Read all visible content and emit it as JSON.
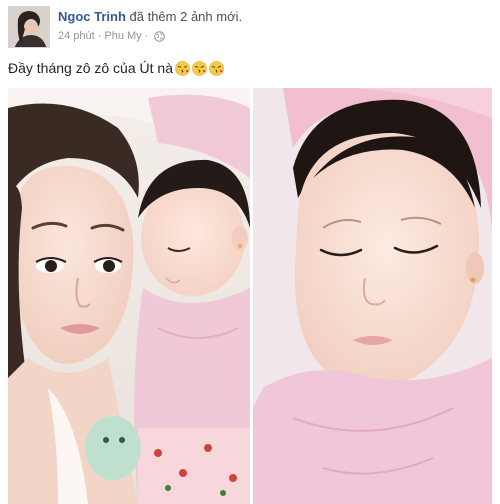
{
  "post": {
    "author_name": "Ngoc Trinh",
    "action": "đã thêm 2 ảnh mới.",
    "time": "24 phút",
    "separator": "·",
    "location": "Phu My",
    "separator2": "·",
    "privacy_icon": "globe-icon",
    "text": "Đầy tháng zô zô của Út nà",
    "emojis": [
      "kiss-emoji",
      "kiss-emoji",
      "kiss-emoji"
    ],
    "photos": [
      "photo-1",
      "photo-2"
    ]
  },
  "colors": {
    "link": "#365899",
    "meta": "#90949c",
    "text": "#1d2129",
    "pink_clothing": "#f0c8d8"
  }
}
